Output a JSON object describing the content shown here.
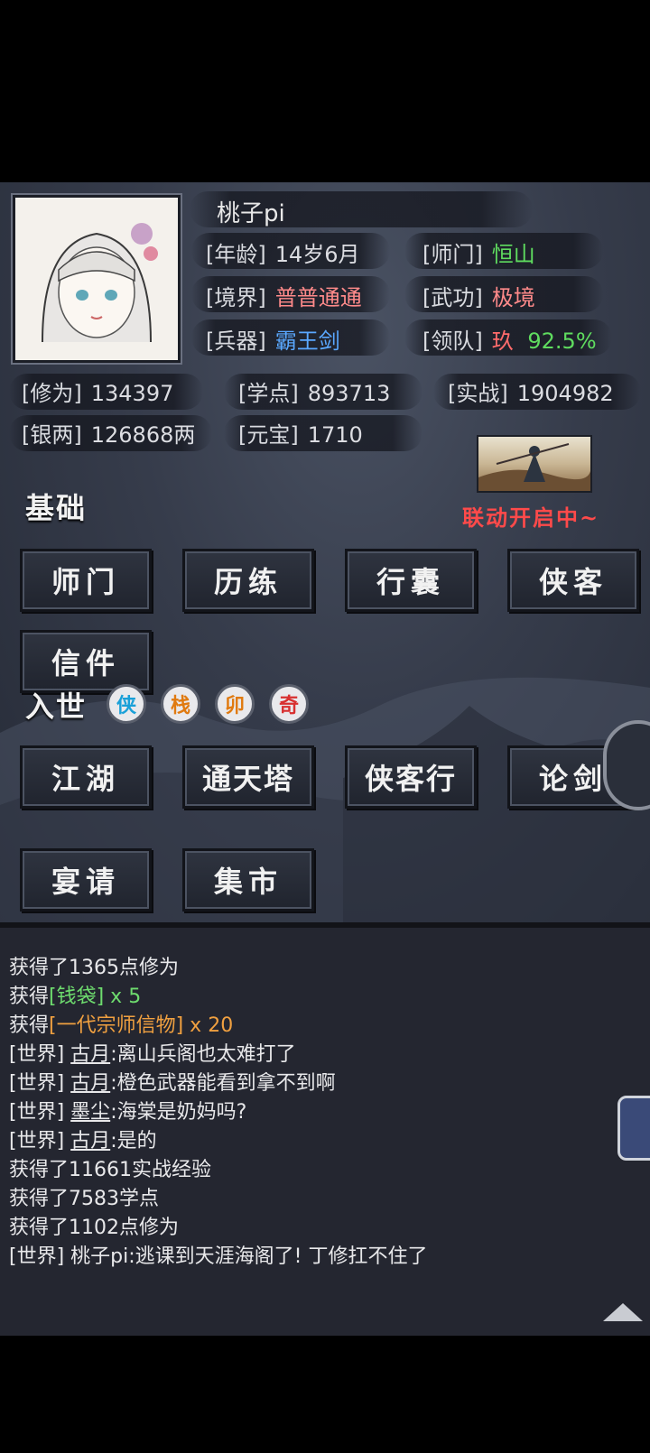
{
  "profile": {
    "name": "桃子pi",
    "age_label": "[年龄]",
    "age": "14岁6月",
    "sect_label": "[师门]",
    "sect": "恒山",
    "realm_label": "[境界]",
    "realm": "普普通通",
    "martial_label": "[武功]",
    "martial": "极境",
    "weapon_label": "[兵器]",
    "weapon": "霸王剑",
    "team_label": "[领队]",
    "team_name": "玖",
    "team_value": "92.5%"
  },
  "stats": {
    "cultivation_label": "[修为]",
    "cultivation": "134397",
    "study_label": "[学点]",
    "study": "893713",
    "combat_label": "[实战]",
    "combat": "1904982",
    "silver_label": "[银两]",
    "silver": "126868两",
    "ingot_label": "[元宝]",
    "ingot": "1710"
  },
  "basic": {
    "title": "基础",
    "promo": "联动开启中~",
    "buttons": [
      "师门",
      "历练",
      "行囊",
      "侠客",
      "信件"
    ]
  },
  "world": {
    "title": "入世",
    "badges": [
      {
        "char": "侠",
        "color": "#1aa0d8"
      },
      {
        "char": "栈",
        "color": "#e07a10"
      },
      {
        "char": "卯",
        "color": "#e07a10"
      },
      {
        "char": "奇",
        "color": "#d83030"
      }
    ],
    "buttons": [
      "江湖",
      "通天塔",
      "侠客行",
      "论剑",
      "宴请",
      "集市"
    ]
  },
  "log": [
    {
      "text": "获得了1365点修为"
    },
    {
      "prefix": "获得",
      "item": "[钱袋]",
      "suffix": " x 5",
      "color": "green"
    },
    {
      "prefix": "获得",
      "item": "[一代宗师信物]",
      "suffix": " x 20",
      "color": "orange"
    },
    {
      "tag": "[世界]",
      "user": "古月",
      "msg": ":离山兵阁也太难打了"
    },
    {
      "tag": "[世界]",
      "user": "古月",
      "msg": ":橙色武器能看到拿不到啊"
    },
    {
      "tag": "[世界]",
      "user": "墨尘",
      "msg": ":海棠是奶妈吗?"
    },
    {
      "tag": "[世界]",
      "user": "古月",
      "msg": ":是的"
    },
    {
      "text": "获得了11661实战经验"
    },
    {
      "text": "获得了7583学点"
    },
    {
      "text": "获得了1102点修为"
    },
    {
      "tag": "[世界]",
      "plain_user": "桃子pi",
      "msg": ":逃课到天涯海阁了! 丁修扛不住了"
    }
  ],
  "colors": {
    "accent_red": "#ff4a4a",
    "green": "#5fdc5f",
    "blue": "#5aa8ff"
  }
}
